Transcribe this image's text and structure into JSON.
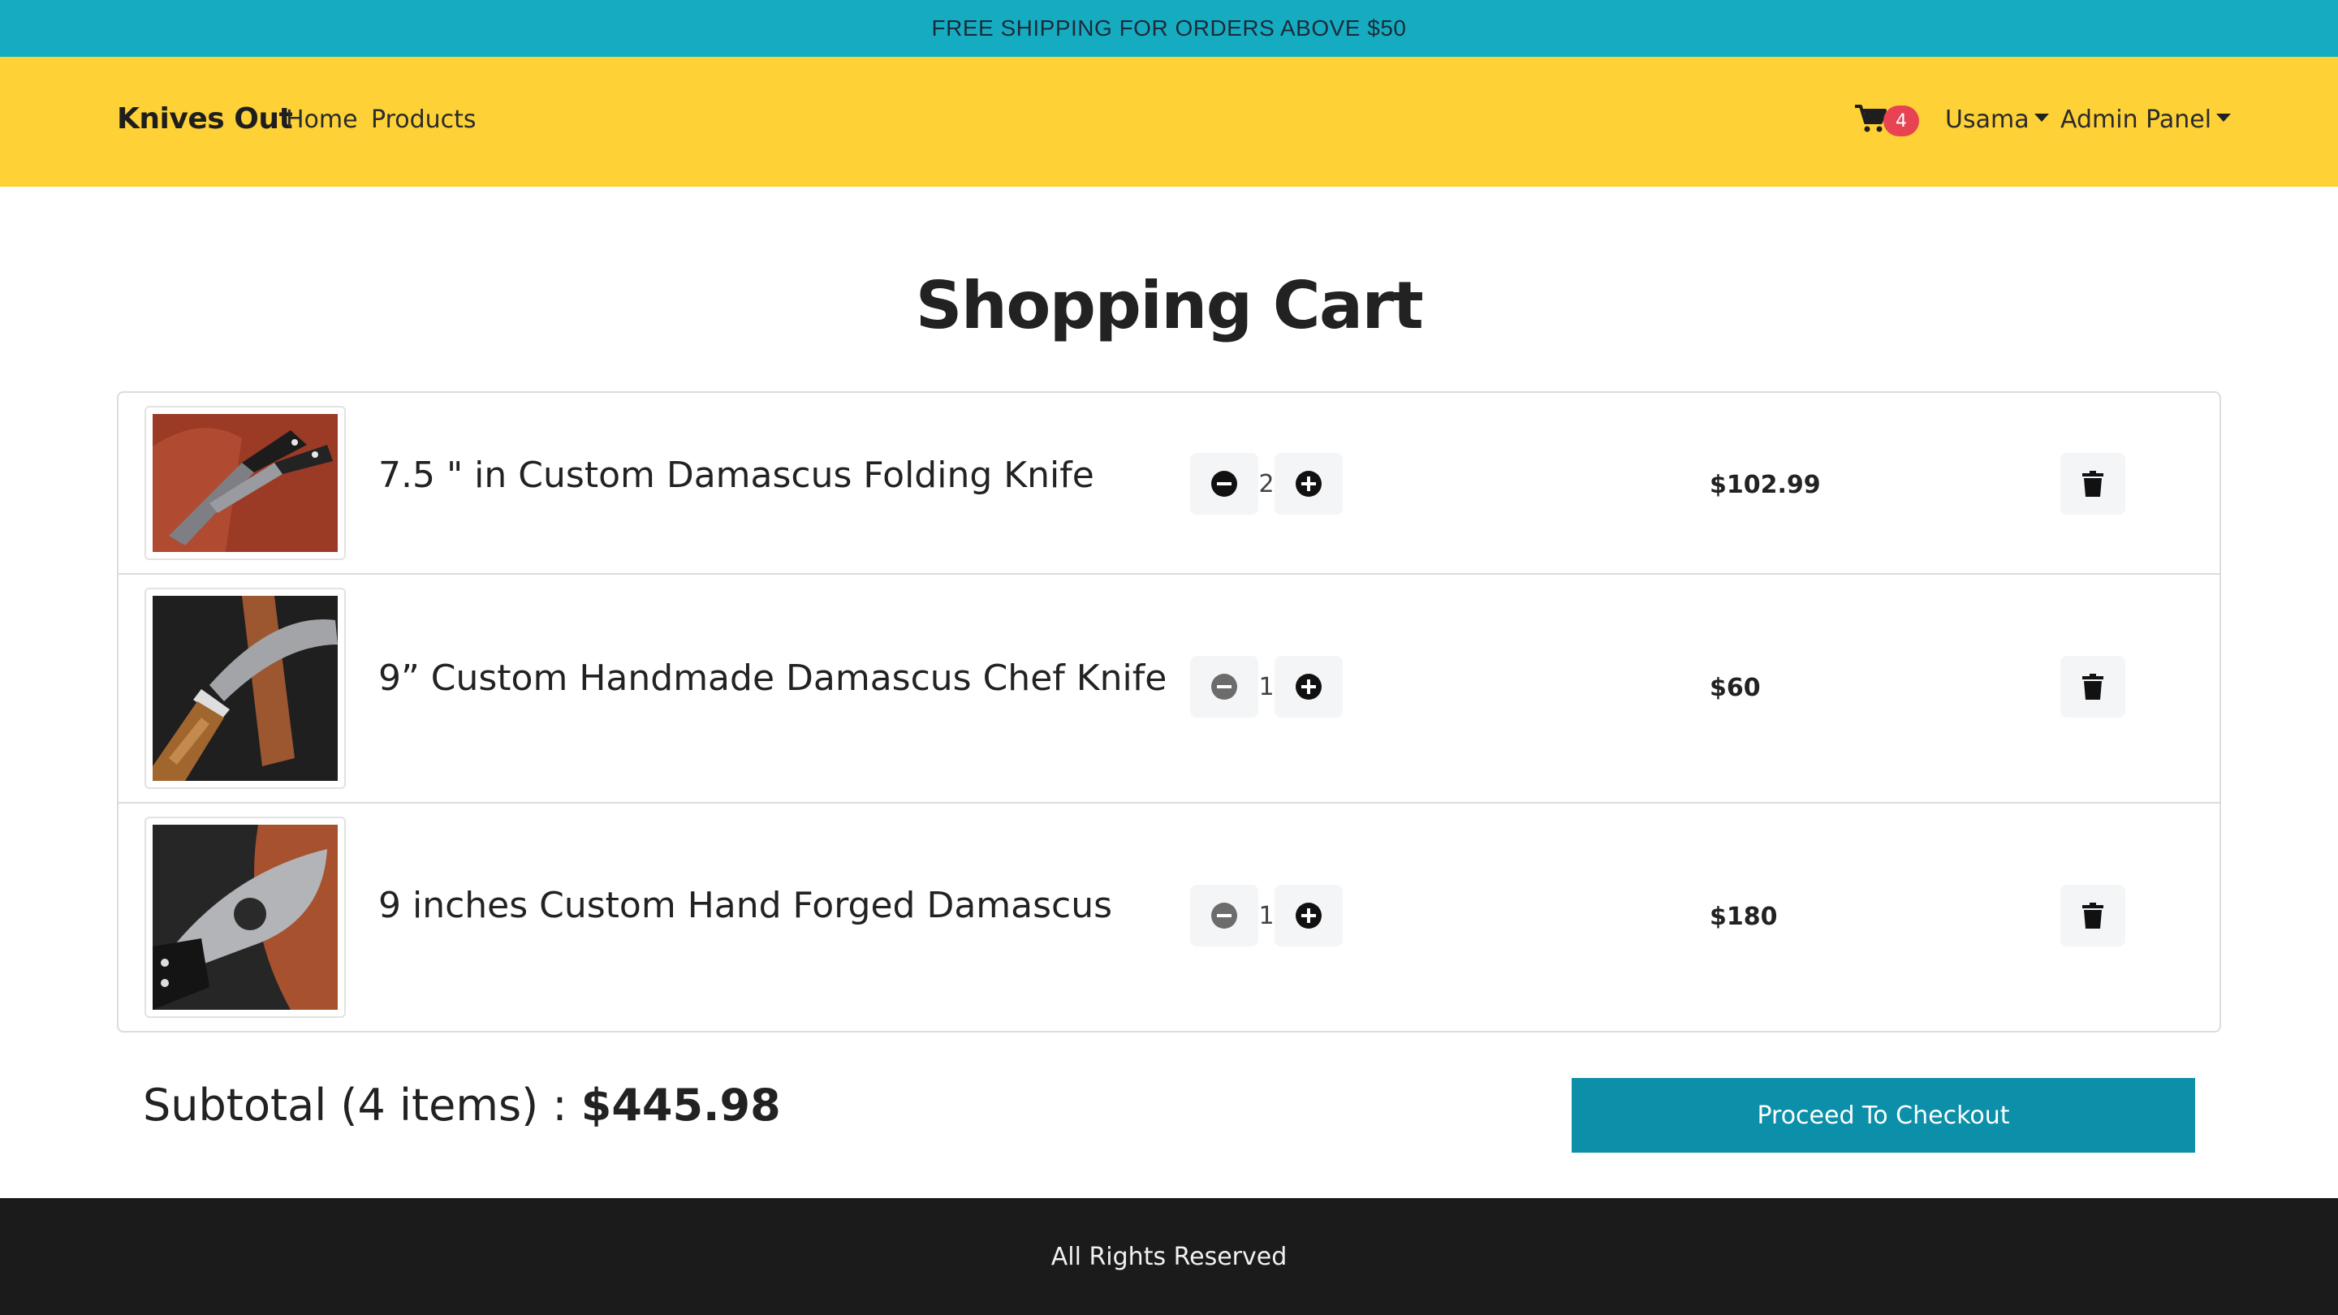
{
  "banner": {
    "text": "FREE SHIPPING FOR ORDERS ABOVE $50"
  },
  "navbar": {
    "brand": "Knives Out",
    "links": [
      "Home",
      "Products"
    ],
    "cart_count": "4",
    "user_menu": "Usama",
    "admin_menu": "Admin Panel"
  },
  "page": {
    "title": "Shopping Cart"
  },
  "cart": {
    "items": [
      {
        "name": "7.5 \" in Custom Damascus Folding Knife",
        "quantity": "2",
        "price": "$102.99"
      },
      {
        "name": "9” Custom Handmade Damascus Chef Knife",
        "quantity": "1",
        "price": "$60"
      },
      {
        "name": "9 inches Custom Hand Forged Damascus",
        "quantity": "1",
        "price": "$180"
      }
    ]
  },
  "summary": {
    "subtotal_label": "Subtotal (4 items) : ",
    "subtotal_value": "$445.98",
    "checkout_label": "Proceed To Checkout"
  },
  "footer": {
    "text": "All Rights Reserved"
  },
  "colors": {
    "banner": "#15acc2",
    "navbar": "#fed136",
    "badge": "#e74352",
    "checkout": "#0c8fa8",
    "footer": "#1b1b1b"
  },
  "icons": {
    "cart": "shopping-cart-icon",
    "minus": "minus-circle-icon",
    "plus": "plus-circle-icon",
    "delete": "trash-icon"
  }
}
